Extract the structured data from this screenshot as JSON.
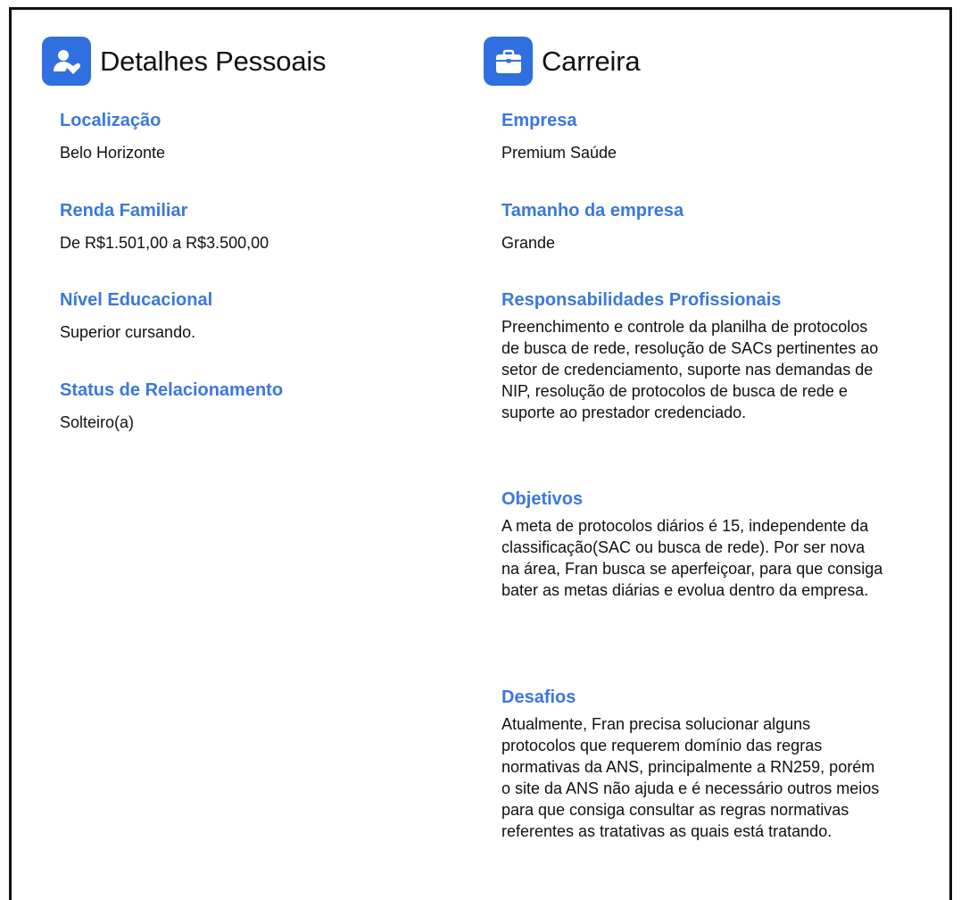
{
  "personal": {
    "title": "Detalhes Pessoais",
    "icon": "user-heart-icon",
    "fields": [
      {
        "label": "Localização",
        "value": "Belo Horizonte"
      },
      {
        "label": "Renda Familiar",
        "value": "De R$1.501,00 a R$3.500,00"
      },
      {
        "label": "Nível Educacional",
        "value": "Superior cursando."
      },
      {
        "label": "Status de Relacionamento",
        "value": "Solteiro(a)"
      }
    ]
  },
  "career": {
    "title": "Carreira",
    "icon": "briefcase-icon",
    "fields": [
      {
        "label": "Empresa",
        "value": "Premium Saúde"
      },
      {
        "label": "Tamanho da empresa",
        "value": "Grande"
      },
      {
        "label": "Responsabilidades Profissionais",
        "value": "Preenchimento e controle da planilha de protocolos de busca de rede, resolução de SACs pertinentes ao setor de credenciamento, suporte nas demandas de NIP, resolução de protocolos de busca de rede e suporte ao prestador credenciado."
      },
      {
        "label": "Objetivos",
        "value": "A meta de protocolos diários é 15, independente da classificação(SAC ou busca de rede). Por ser nova na área, Fran busca se aperfeiçoar, para que consiga bater as metas diárias e evolua dentro da empresa."
      },
      {
        "label": "Desafios",
        "value": "Atualmente, Fran precisa solucionar alguns protocolos que requerem domínio das regras normativas da ANS, principalmente a RN259, porém o site da ANS não ajuda e é necessário outros meios para que consiga consultar as regras normativas referentes as tratativas as quais está tratando."
      }
    ]
  },
  "colors": {
    "accent": "#2f6fe0",
    "label": "#3a78dd",
    "text": "#111111"
  }
}
